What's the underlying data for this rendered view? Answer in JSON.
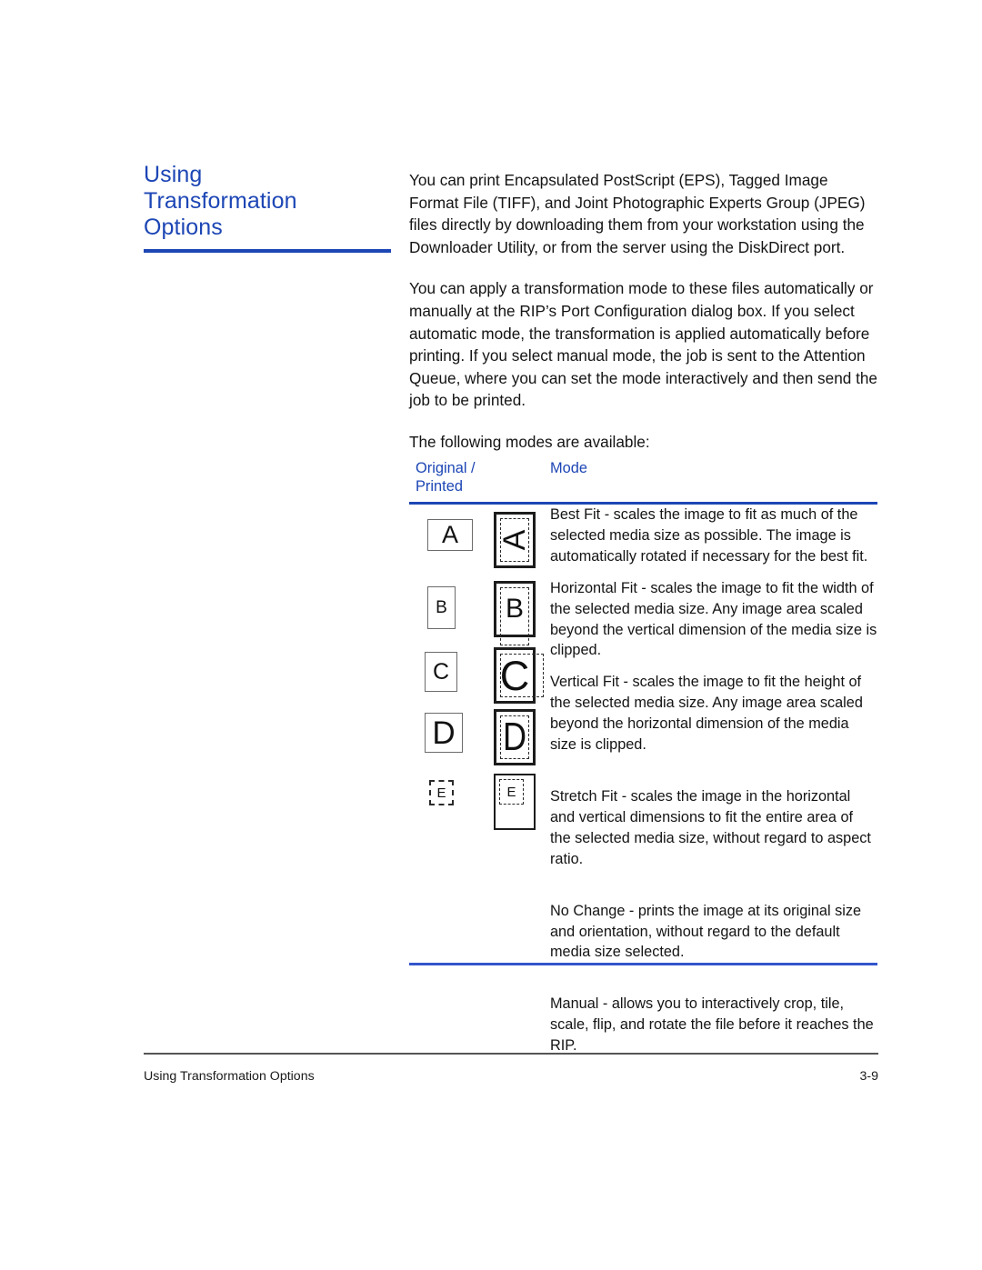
{
  "heading": {
    "lines": [
      "Using",
      "Transformation",
      "Options"
    ],
    "rule_color": "#1d46b5",
    "text_color": "#1d46b5"
  },
  "body": {
    "paragraphs": [
      "You can print Encapsulated PostScript (EPS), Tagged Image Format File (TIFF), and Joint Photographic Experts Group (JPEG) files directly by downloading them from your workstation using the Downloader Utility, or from the server using the DiskDirect port.",
      "You can apply a transformation mode to these files automatically or manually at the RIP’s Port Configuration dialog box. If you select automatic mode, the transformation is applied automatically before printing. If you select manual mode, the job is sent to the Attention Queue, where you can set the mode interactively and then send the job to be printed.",
      "The following modes are available:"
    ]
  },
  "figure": {
    "header_original": "Original / Printed",
    "header_original_line1": "Original /",
    "header_original_line2": "Printed",
    "header_mode": "Mode",
    "header_color": "#1d46b5",
    "rule_top_color": "#1d46b5",
    "rule_bottom_color": "#3355cc",
    "rows": [
      {
        "letter": "A",
        "original_shape": "landscape-thin-box",
        "printed_shape": "portrait-thick-box-rotated-letter-dashed-inner",
        "mode": "Best Fit - scales the image to fit as much of the selected media size as possible. The image is automatically rotated if necessary for the best fit."
      },
      {
        "letter": "B",
        "original_shape": "small-portrait-thin-box",
        "printed_shape": "portrait-thick-box-dashed-inner-overflow-bottom",
        "mode": "Horizontal Fit - scales the image to fit the width of the selected media size. Any image area scaled beyond the vertical dimension of the media size is clipped."
      },
      {
        "letter": "C",
        "original_shape": "small-portrait-thin-box",
        "printed_shape": "portrait-thick-box-dashed-inner-overflow-right",
        "mode": "Vertical Fit - scales the image to fit the height of the selected media size. Any image area scaled beyond the horizontal dimension of the media size is clipped."
      },
      {
        "letter": "D",
        "original_shape": "square-thin-box",
        "printed_shape": "portrait-thick-box-dashed-inner-stretched-letter",
        "mode": "Stretch Fit - scales the image in the horizontal and vertical dimensions to fit the entire area of the selected media size, without regard to aspect ratio."
      },
      {
        "letter": "E",
        "original_shape": "small-dashed-box",
        "printed_shape": "portrait-thin-box-small-dashed-letter-top-left",
        "mode": "No Change - prints the image at its original size and orientation, without regard to the default media size selected."
      },
      {
        "letter": "",
        "original_shape": "none",
        "printed_shape": "none",
        "mode": "Manual - allows you to interactively crop, tile, scale, flip, and rotate the file before it reaches the RIP."
      }
    ]
  },
  "footer": {
    "left": "Using Transformation Options",
    "page_number": "3-9"
  }
}
